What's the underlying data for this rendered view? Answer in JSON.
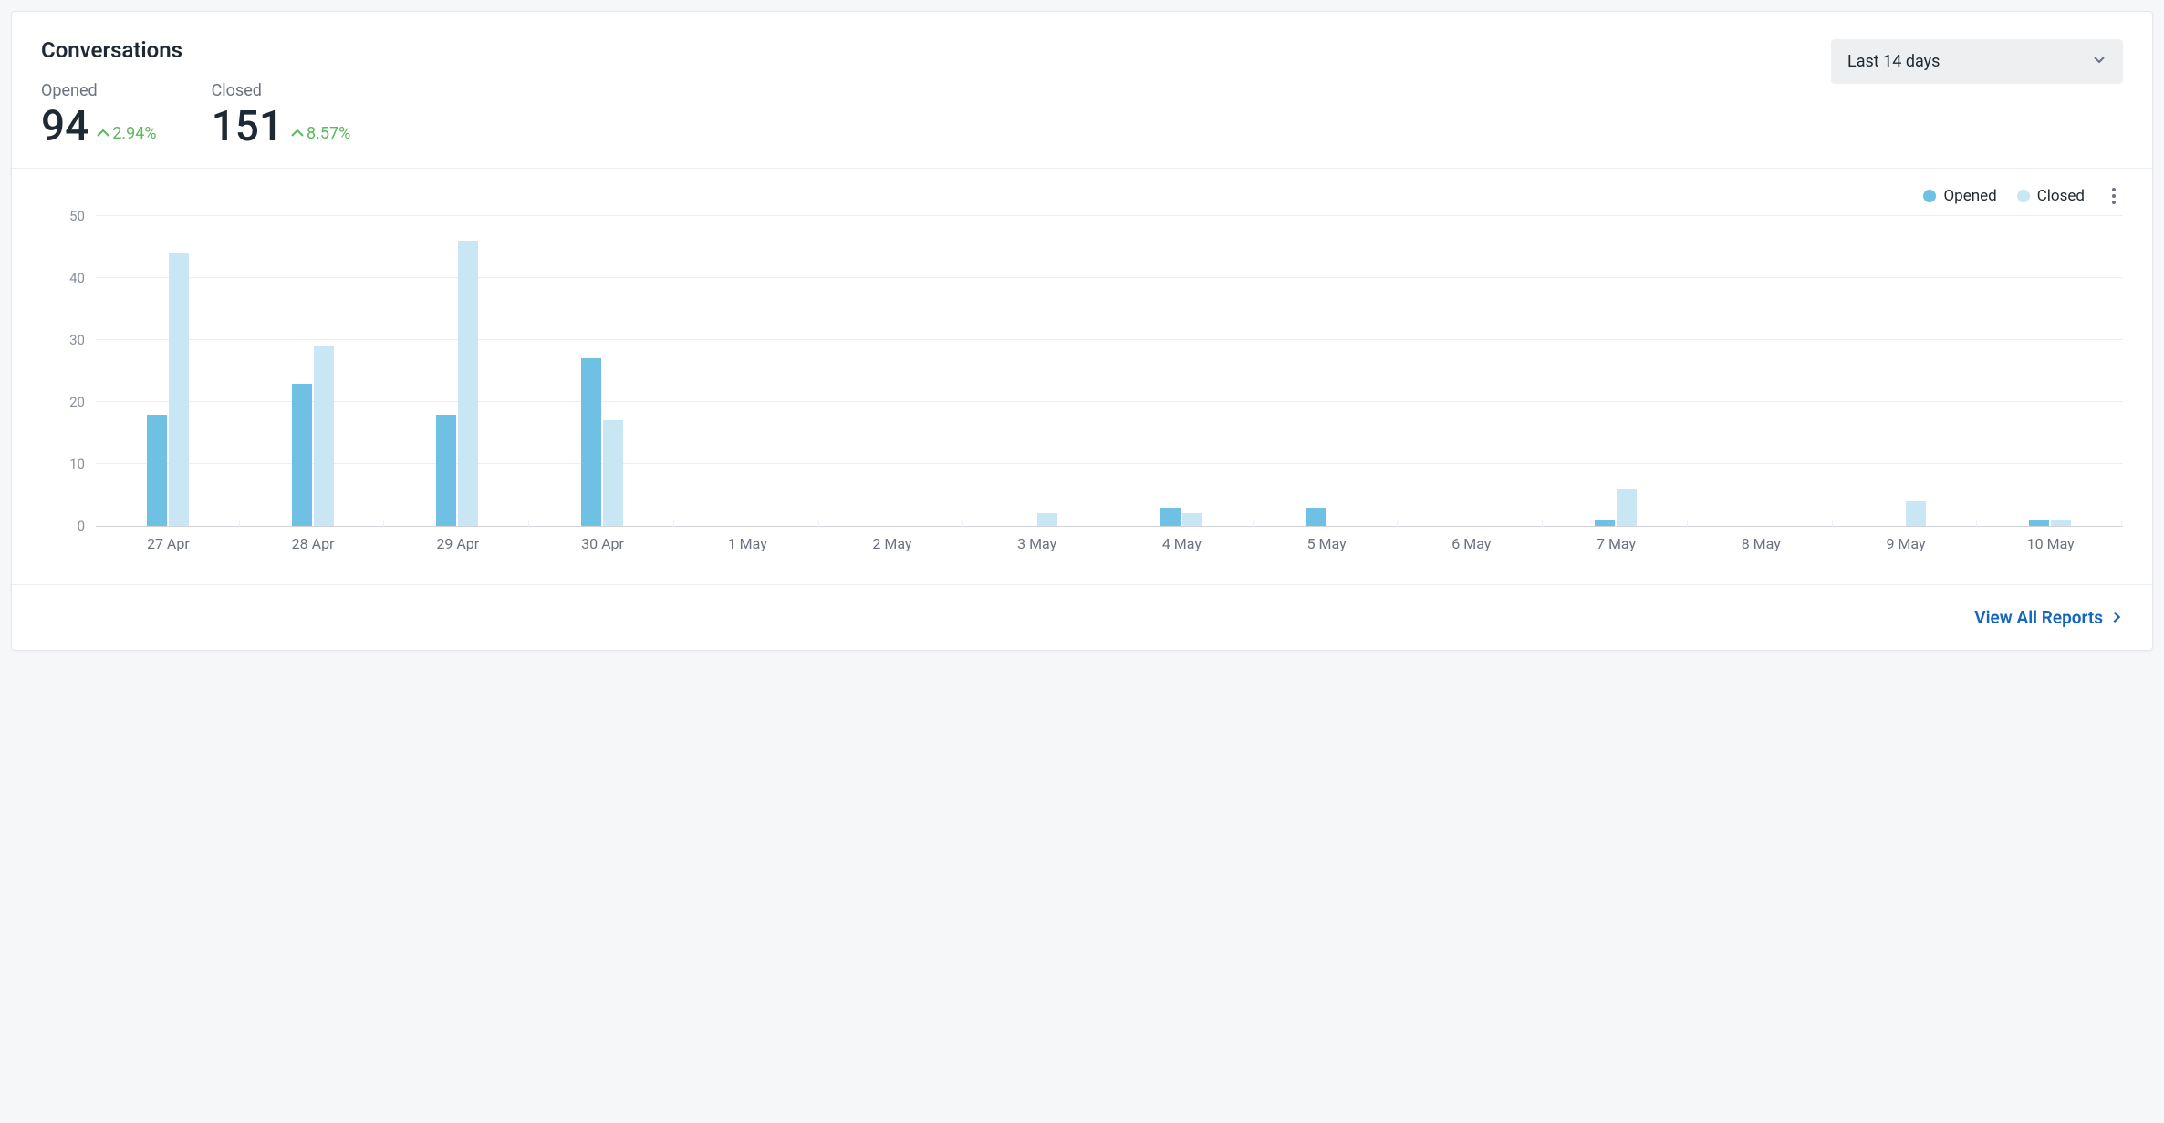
{
  "title": "Conversations",
  "range": {
    "selected": "Last 14 days"
  },
  "metrics": {
    "opened": {
      "label": "Opened",
      "value": "94",
      "delta": "2.94%",
      "direction": "up"
    },
    "closed": {
      "label": "Closed",
      "value": "151",
      "delta": "8.57%",
      "direction": "up"
    }
  },
  "legend": {
    "opened": "Opened",
    "closed": "Closed"
  },
  "colors": {
    "opened": "#6ec1e4",
    "closed": "#c9e6f5",
    "delta_up": "#5cb85c",
    "link": "#1565c0"
  },
  "footer": {
    "view_all": "View All Reports"
  },
  "chart_data": {
    "type": "bar",
    "categories": [
      "27 Apr",
      "28 Apr",
      "29 Apr",
      "30 Apr",
      "1 May",
      "2 May",
      "3 May",
      "4 May",
      "5 May",
      "6 May",
      "7 May",
      "8 May",
      "9 May",
      "10 May"
    ],
    "series": [
      {
        "name": "Opened",
        "values": [
          18,
          23,
          18,
          27,
          0,
          0,
          0,
          3,
          3,
          0,
          1,
          0,
          0,
          1
        ]
      },
      {
        "name": "Closed",
        "values": [
          44,
          29,
          46,
          17,
          0,
          0,
          2,
          2,
          0,
          0,
          6,
          0,
          4,
          1
        ]
      }
    ],
    "title": "",
    "xlabel": "",
    "ylabel": "",
    "ylim": [
      0,
      50
    ],
    "yticks": [
      0,
      10,
      20,
      30,
      40,
      50
    ],
    "legend_position": "top-right",
    "grid": true
  }
}
